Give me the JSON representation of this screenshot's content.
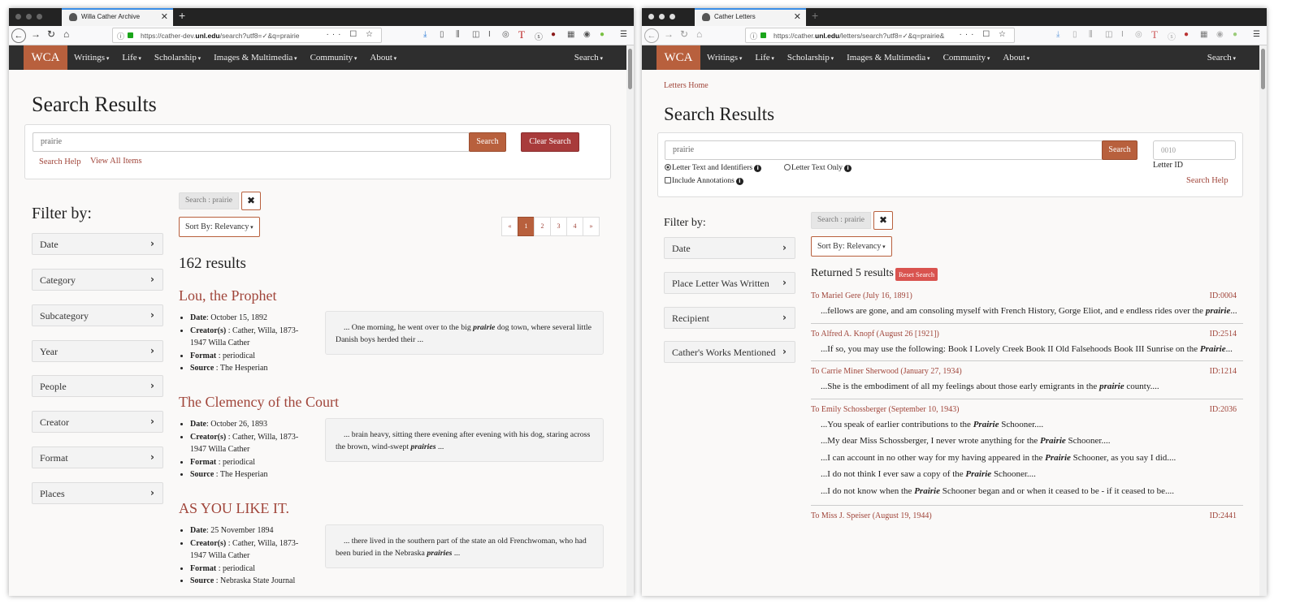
{
  "windows": [
    {
      "tab_title": "Willa Cather Archive",
      "url_prefix": "https://cather-dev.",
      "url_domain": "unl.edu",
      "url_path": "/search?utf8=✓&q=prairie",
      "nav": {
        "brand": "WCA",
        "menu": [
          "Writings",
          "Life",
          "Scholarship",
          "Images & Multimedia",
          "Community",
          "About"
        ],
        "search": "Search"
      },
      "page_title": "Search Results",
      "search": {
        "value": "prairie",
        "button": "Search",
        "clear_button": "Clear Search",
        "help_link": "Search Help",
        "view_all_link": "View All Items"
      },
      "filter_heading": "Filter by:",
      "filters": [
        "Date",
        "Category",
        "Subcategory",
        "Year",
        "People",
        "Creator",
        "Format",
        "Places"
      ],
      "chip": "Search : prairie",
      "sort": "Sort By: Relevancy",
      "pagination": [
        "«",
        "1",
        "2",
        "3",
        "4",
        "»"
      ],
      "active_page": "1",
      "result_count": "162 results",
      "results": [
        {
          "title": "Lou, the Prophet",
          "date_label": "Date",
          "date": ": October 15, 1892",
          "creator_label": "Creator(s)",
          "creator": " : Cather, Willa, 1873-1947 Willa Cather",
          "format_label": "Format",
          "format": " : periodical",
          "source_label": "Source",
          "source": " : The Hesperian",
          "snippet_before": "... One morning, he went over to the big ",
          "snippet_hit": "prairie",
          "snippet_after": " dog town, where several little Danish boys herded their ..."
        },
        {
          "title": "The Clemency of the Court",
          "date_label": "Date",
          "date": ": October 26, 1893",
          "creator_label": "Creator(s)",
          "creator": " : Cather, Willa, 1873-1947 Willa Cather",
          "format_label": "Format",
          "format": " : periodical",
          "source_label": "Source",
          "source": " : The Hesperian",
          "snippet_before": "... brain heavy, sitting there evening after evening with his dog, staring across the brown, wind-swept ",
          "snippet_hit": "prairies",
          "snippet_after": " ..."
        },
        {
          "title": "AS YOU LIKE IT.",
          "date_label": "Date",
          "date": ": 25 November 1894",
          "creator_label": "Creator(s)",
          "creator": " : Cather, Willa, 1873-1947 Willa Cather",
          "format_label": "Format",
          "format": " : periodical",
          "source_label": "Source",
          "source": " : Nebraska State Journal",
          "snippet_before": "... there lived in the southern part of the state an old Frenchwoman, who had been buried in the Nebraska ",
          "snippet_hit": "prairies",
          "snippet_after": " ..."
        }
      ]
    },
    {
      "tab_title": "Cather Letters",
      "url_prefix": "https://cather.",
      "url_domain": "unl.edu",
      "url_path": "/letters/search?utf8=✓&q=prairie&",
      "nav": {
        "brand": "WCA",
        "menu": [
          "Writings",
          "Life",
          "Scholarship",
          "Images & Multimedia",
          "Community",
          "About"
        ],
        "search": "Search"
      },
      "breadcrumb": "Letters Home",
      "page_title": "Search Results",
      "search": {
        "value": "prairie",
        "button": "Search",
        "id_placeholder": "0010",
        "id_label": "Letter ID",
        "help_link": "Search Help",
        "option_text_ids": "Letter Text and Identifiers",
        "option_text_only": "Letter Text Only",
        "option_annotations": "Include Annotations"
      },
      "filter_heading": "Filter by:",
      "filters": [
        "Date",
        "Place Letter Was Written",
        "Recipient",
        "Cather's Works Mentioned"
      ],
      "chip": "Search : prairie",
      "sort": "Sort By: Relevancy",
      "returned": "Returned 5 results",
      "reset_button": "Reset Search",
      "letters": [
        {
          "title": "To Mariel Gere (July 16, 1891)",
          "id": "ID:0004",
          "snippets": [
            {
              "before": "...fellows are gone, and am consoling myself with French History, Gorge Eliot, and e endless rides over the ",
              "hit": "prairie",
              "after": "..."
            }
          ]
        },
        {
          "title": "To Alfred A. Knopf (August 26 [1921])",
          "id": "ID:2514",
          "snippets": [
            {
              "before": "...If so, you may use the following: Book I Lovely Creek Book II Old Falsehoods Book III Sunrise on the ",
              "hit": "Prairie",
              "after": "..."
            }
          ]
        },
        {
          "title": "To Carrie Miner Sherwood (January 27, 1934)",
          "id": "ID:1214",
          "snippets": [
            {
              "before": "...She is the embodiment of all my feelings about those early emigrants in the ",
              "hit": "prairie",
              "after": " county...."
            }
          ]
        },
        {
          "title": "To Emily Schossberger (September 10, 1943)",
          "id": "ID:2036",
          "snippets": [
            {
              "before": "...You speak of earlier contributions to the ",
              "hit": "Prairie",
              "after": " Schooner...."
            },
            {
              "before": "...My dear Miss Schossberger, I never wrote anything for the ",
              "hit": "Prairie",
              "after": " Schooner...."
            },
            {
              "before": "...I can account in no other way for my having appeared in the ",
              "hit": "Prairie",
              "after": " Schooner, as you say I did...."
            },
            {
              "before": "...I do not think I ever saw a copy of the ",
              "hit": "Prairie",
              "after": " Schooner...."
            },
            {
              "before": "...I do not know when the ",
              "hit": "Prairie",
              "after": " Schooner began and or when it ceased to be - if it ceased to be...."
            }
          ]
        },
        {
          "title": "To Miss J. Speiser (August 19, 1944)",
          "id": "ID:2441",
          "snippets": []
        }
      ]
    }
  ]
}
